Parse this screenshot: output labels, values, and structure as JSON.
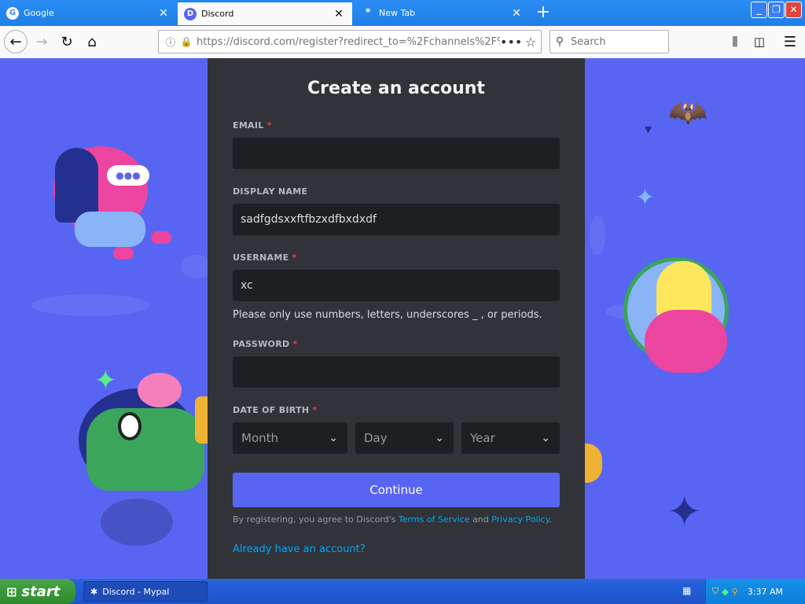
{
  "browser": {
    "tabs": [
      {
        "label": "Google",
        "favicon": "G",
        "active": false
      },
      {
        "label": "Discord",
        "favicon": "D",
        "active": true
      },
      {
        "label": "New Tab",
        "favicon": "*",
        "active": false
      }
    ],
    "url": "https://discord.com/register?redirect_to=%2Fchannels%2F%",
    "search_placeholder": "Search"
  },
  "form": {
    "title": "Create an account",
    "email_label": "EMAIL",
    "email_value": "",
    "display_name_label": "DISPLAY NAME",
    "display_name_value": "sadfgdsxxftfbzxdfbxdxdf",
    "username_label": "USERNAME",
    "username_value": "xc",
    "username_hint": "Please only use numbers, letters, underscores _ , or periods.",
    "password_label": "PASSWORD",
    "password_value": "",
    "dob_label": "DATE OF BIRTH",
    "required_mark": "*",
    "dob_month": "Month",
    "dob_day": "Day",
    "dob_year": "Year",
    "continue_label": "Continue",
    "terms_prefix": "By registering, you agree to Discord's ",
    "terms_link": "Terms of Service",
    "terms_and": " and ",
    "privacy_link": "Privacy Policy",
    "terms_suffix": ".",
    "login_link": "Already have an account?"
  },
  "taskbar": {
    "start_label": "start",
    "task_label": "Discord - Mypal",
    "clock": "3:37 AM"
  },
  "colors": {
    "brand": "#5865f2",
    "card": "#313338",
    "input": "#1e1f22",
    "link": "#00a8fc",
    "required": "#f23f42"
  }
}
